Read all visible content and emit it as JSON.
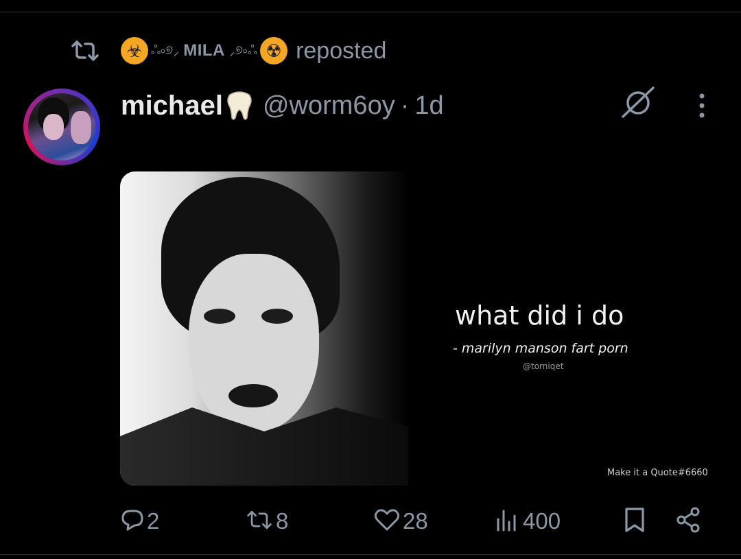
{
  "repost": {
    "icon": "repost-icon",
    "badge_left": "biohazard-icon",
    "ornament_left": "ஃ৹୭⸝",
    "name": "MILA",
    "ornament_right": "⸝୭৹ஃ",
    "badge_right": "radioactive-icon",
    "label": "reposted",
    "badge_color": "#f5a623"
  },
  "post": {
    "display_name": "michael",
    "name_emoji": "tooth-icon",
    "handle": "@worm6oy",
    "separator": "·",
    "time": "1d",
    "avatar": "avatar-photo",
    "header_icons": [
      "grok-icon",
      "more-icon"
    ]
  },
  "media": {
    "quote_text": "what did i do",
    "quote_attribution": "- marilyn manson fart porn",
    "quote_credit": "@torniqet",
    "watermark": "Make it a Quote#6660"
  },
  "actions": {
    "reply_count": "2",
    "repost_count": "8",
    "like_count": "28",
    "view_count": "400"
  },
  "colors": {
    "background": "#000000",
    "text": "#e7e9ea",
    "muted": "#8b98a5",
    "divider": "#2f3336"
  }
}
